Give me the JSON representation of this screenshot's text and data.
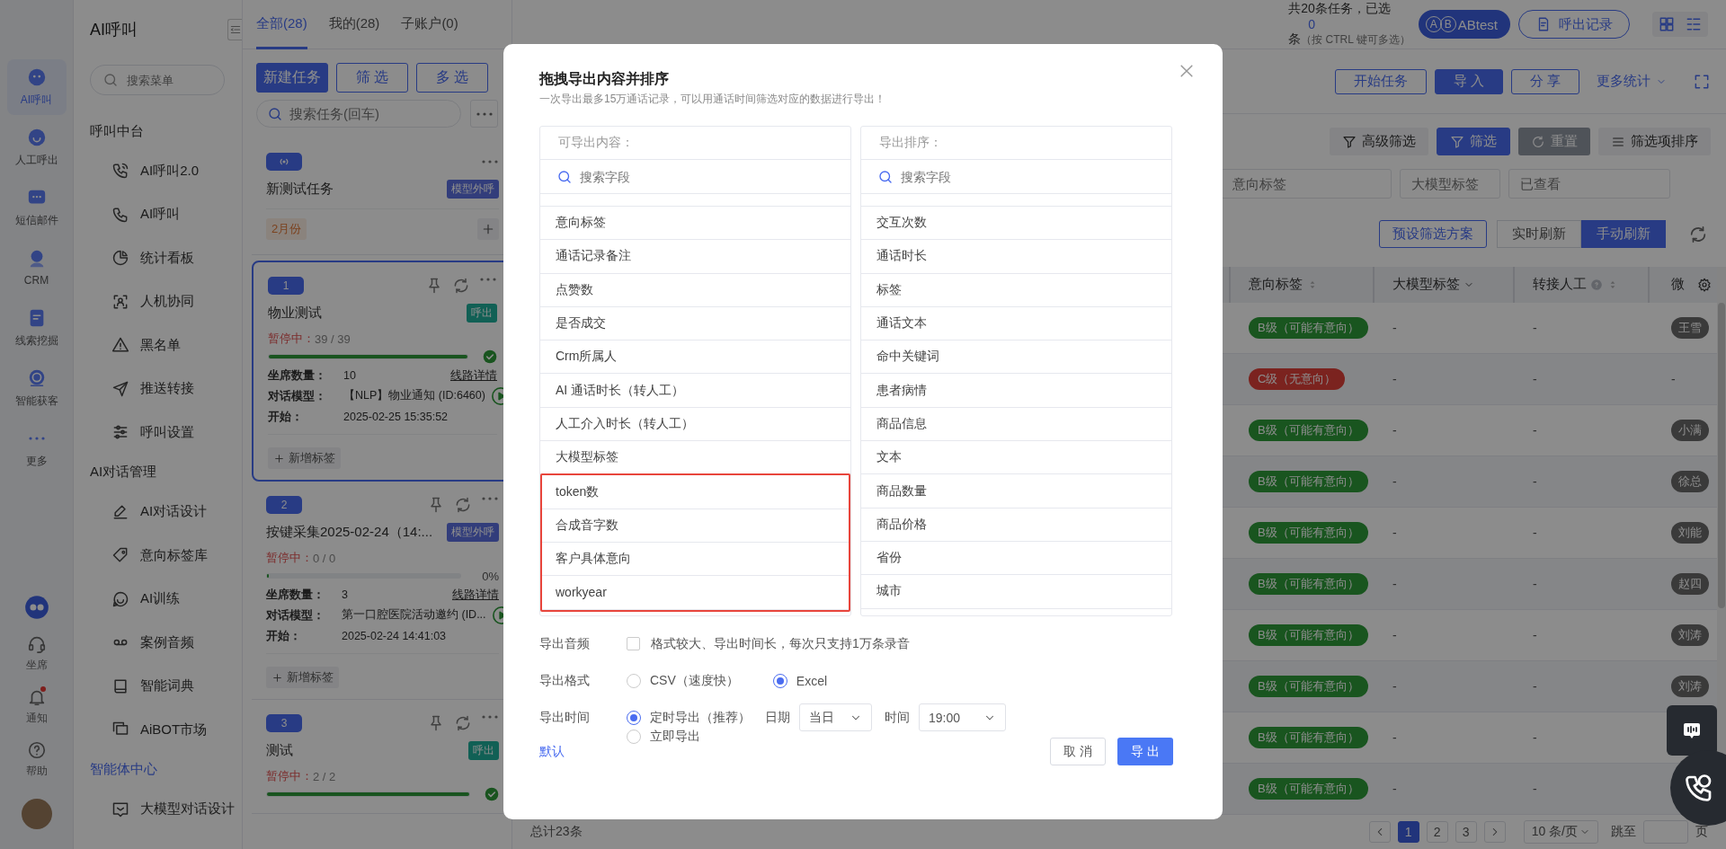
{
  "rail": {
    "items": [
      {
        "label": "AI呼叫",
        "selected": true
      },
      {
        "label": "人工呼出",
        "selected": false
      },
      {
        "label": "短信邮件",
        "selected": false
      },
      {
        "label": "CRM",
        "selected": false
      },
      {
        "label": "线索挖掘",
        "selected": false
      },
      {
        "label": "智能获客",
        "selected": false
      },
      {
        "label": "更多",
        "selected": false
      }
    ],
    "bottom": [
      {
        "label": "坐席",
        "badge": false
      },
      {
        "label": "通知",
        "badge": true
      },
      {
        "label": "帮助",
        "badge": false
      }
    ]
  },
  "menu": {
    "title": "AI呼叫",
    "search": {
      "placeholder": "搜索菜单"
    },
    "groups": [
      {
        "title": "呼叫中台",
        "selected": false,
        "items": [
          "AI呼叫2.0",
          "AI呼叫",
          "统计看板",
          "人机协同",
          "黑名单",
          "推送转接",
          "呼叫设置"
        ]
      },
      {
        "title": "AI对话管理",
        "selected": false,
        "items": [
          "AI对话设计",
          "意向标签库",
          "AI训练",
          "案例音频",
          "智能词典",
          "AiBOT市场"
        ]
      },
      {
        "title": "智能体中心",
        "selected": true,
        "items": [
          "大模型对话设计"
        ]
      }
    ]
  },
  "task_panel": {
    "tabs": [
      {
        "label": "全部(28)",
        "selected": true
      },
      {
        "label": "我的(28)",
        "selected": false
      },
      {
        "label": "子账户(0)",
        "selected": false
      }
    ],
    "buttons": [
      {
        "label": "新建任务",
        "kind": "primary"
      },
      {
        "label": "筛 选",
        "kind": "outline"
      },
      {
        "label": "多 选",
        "kind": "outline"
      }
    ],
    "search": {
      "placeholder": "搜索任务(回车)"
    },
    "group_card": {
      "title": "新测试任务",
      "tag": {
        "text": "模型外呼",
        "color": "#323d7b"
      },
      "month_tag": "2月份"
    },
    "tasks": [
      {
        "number": "1",
        "selected": true,
        "name": "物业测试",
        "tag": {
          "text": "呼出",
          "color": "#116055"
        },
        "status": "暂停中：",
        "count": "39 / 39",
        "level": 1,
        "fields": [
          {
            "label": "坐席数量：",
            "value": "10"
          },
          {
            "label": "对话模型：",
            "value": "【NLP】物业通知 (ID:6460)"
          },
          {
            "label": "开始：",
            "value": "2025-02-25 15:35:52"
          }
        ],
        "link": "线路详情",
        "add_tag": "新增标签"
      },
      {
        "number": "2",
        "selected": false,
        "name": "按键采集2025-02-24（14:...",
        "tag": {
          "text": "模型外呼",
          "color": "#323d7b"
        },
        "status": "暂停中：",
        "count": "0 / 0",
        "level": 0,
        "percent": "0%",
        "fields": [
          {
            "label": "坐席数量：",
            "value": "3"
          },
          {
            "label": "对话模型：",
            "value": "第一口腔医院活动邀约 (ID..."
          },
          {
            "label": "开始：",
            "value": "2025-02-24 14:41:03"
          }
        ],
        "link": "线路详情",
        "add_tag": "新增标签"
      },
      {
        "number": "3",
        "selected": false,
        "name": "测试",
        "tag": {
          "text": "呼出",
          "color": "#116055"
        },
        "status": "暂停中：",
        "count": "2 / 2",
        "level": 1
      }
    ]
  },
  "main": {
    "summary": [
      {
        "text": "共20条任务，已选",
        "kind": "plain"
      },
      {
        "text": "0",
        "kind": "count"
      },
      {
        "text": "条",
        "kind": "plain"
      }
    ],
    "summary_hint": "（按 CTRL 键可多选）",
    "ab_letters": [
      "A",
      "B"
    ],
    "ab_button": "ABtest",
    "records_button": "呼出记录",
    "actions": [
      {
        "label": "开始任务",
        "kind": "outline"
      },
      {
        "label": "导 入",
        "kind": "primary"
      },
      {
        "label": "分 享",
        "kind": "outline"
      },
      {
        "label": "更多统计",
        "kind": "dropdown"
      }
    ],
    "filter_actions": [
      {
        "label": "高级筛选",
        "kind": "plain"
      },
      {
        "label": "筛选",
        "kind": "primary"
      },
      {
        "label": "重置",
        "kind": "dark"
      },
      {
        "label": "筛选项排序",
        "kind": "plain"
      }
    ],
    "filter_fields": [
      {
        "placeholder": "意向标签"
      },
      {
        "placeholder": "大模型标签"
      },
      {
        "placeholder": "已查看"
      }
    ],
    "preset_button": "预设筛选方案",
    "refresh_modes": [
      {
        "label": "实时刷新",
        "selected": false
      },
      {
        "label": "手动刷新",
        "selected": true
      }
    ],
    "table": {
      "columns": [
        {
          "label": "意向标签",
          "kind": "sortable"
        },
        {
          "label": "大模型标签",
          "kind": "dropdown"
        },
        {
          "label": "转接人工",
          "kind": "help_sortable"
        },
        {
          "label": "微",
          "kind": "plain"
        }
      ],
      "rows": [
        {
          "intent": {
            "text": "B级（可能有意向）",
            "color": "#1a5520"
          },
          "model_tag": "-",
          "transfer": "-",
          "agent": {
            "text": "王雪",
            "kind": "badge"
          }
        },
        {
          "intent": {
            "text": "C级（无意向）",
            "color": "#7b2320"
          },
          "model_tag": "-",
          "transfer": "-",
          "agent": {
            "text": "-",
            "kind": "plain"
          }
        },
        {
          "intent": {
            "text": "B级（可能有意向）",
            "color": "#1a5520"
          },
          "model_tag": "-",
          "transfer": "-",
          "agent": {
            "text": "小满",
            "kind": "badge"
          }
        },
        {
          "intent": {
            "text": "B级（可能有意向）",
            "color": "#1a5520"
          },
          "model_tag": "-",
          "transfer": "-",
          "agent": {
            "text": "徐总",
            "kind": "badge"
          }
        },
        {
          "intent": {
            "text": "B级（可能有意向）",
            "color": "#1a5520"
          },
          "model_tag": "-",
          "transfer": "-",
          "agent": {
            "text": "刘能",
            "kind": "badge"
          }
        },
        {
          "intent": {
            "text": "B级（可能有意向）",
            "color": "#1a5520"
          },
          "model_tag": "-",
          "transfer": "-",
          "agent": {
            "text": "赵四",
            "kind": "badge"
          }
        },
        {
          "intent": {
            "text": "B级（可能有意向）",
            "color": "#1a5520"
          },
          "model_tag": "-",
          "transfer": "-",
          "agent": {
            "text": "刘涛",
            "kind": "badge"
          }
        },
        {
          "intent": {
            "text": "B级（可能有意向）",
            "color": "#1a5520"
          },
          "model_tag": "-",
          "transfer": "-",
          "agent": {
            "text": "刘涛",
            "kind": "badge"
          }
        },
        {
          "intent": {
            "text": "B级（可能有意向）",
            "color": "#1a5520"
          },
          "model_tag": "-",
          "transfer": "-"
        },
        {
          "intent": {
            "text": "B级（可能有意向）",
            "color": "#1a5520"
          },
          "model_tag": "-",
          "transfer": "-"
        }
      ]
    },
    "footer": {
      "total": "总计23条",
      "pages": [
        {
          "label": "1",
          "selected": true
        },
        {
          "label": "2",
          "selected": false
        },
        {
          "label": "3",
          "selected": false
        }
      ],
      "page_size": "10 条/页",
      "jump_label": "跳至",
      "page_unit": "页"
    }
  },
  "modal": {
    "title": "拖拽导出内容并排序",
    "subtitle": "一次导出最多15万通话记录，可以用通话时间筛选对应的数据进行导出！",
    "panels": [
      {
        "header": "可导出内容：",
        "search_placeholder": "搜索字段",
        "items": [
          {
            "label": "意向标签",
            "highlighted": false
          },
          {
            "label": "通话记录备注",
            "highlighted": false
          },
          {
            "label": "点赞数",
            "highlighted": false
          },
          {
            "label": "是否成交",
            "highlighted": false
          },
          {
            "label": "Crm所属人",
            "highlighted": false
          },
          {
            "label": "AI 通话时长（转人工）",
            "highlighted": false
          },
          {
            "label": "人工介入时长（转人工）",
            "highlighted": false
          },
          {
            "label": "大模型标签",
            "highlighted": false
          },
          {
            "label": "token数",
            "highlighted": true
          },
          {
            "label": "合成音字数",
            "highlighted": true
          },
          {
            "label": "客户具体意向",
            "highlighted": true
          },
          {
            "label": "workyear",
            "highlighted": true
          }
        ]
      },
      {
        "header": "导出排序：",
        "search_placeholder": "搜索字段",
        "items": [
          {
            "label": "交互次数",
            "highlighted": false
          },
          {
            "label": "通话时长",
            "highlighted": false
          },
          {
            "label": "标签",
            "highlighted": false
          },
          {
            "label": "通话文本",
            "highlighted": false
          },
          {
            "label": "命中关键词",
            "highlighted": false
          },
          {
            "label": "患者病情",
            "highlighted": false
          },
          {
            "label": "商品信息",
            "highlighted": false
          },
          {
            "label": "文本",
            "highlighted": false
          },
          {
            "label": "商品数量",
            "highlighted": false
          },
          {
            "label": "商品价格",
            "highlighted": false
          },
          {
            "label": "省份",
            "highlighted": false
          },
          {
            "label": "城市",
            "highlighted": false
          }
        ]
      }
    ],
    "audio": {
      "label": "导出音频",
      "checked": false,
      "text": "格式较大、导出时间长，每次只支持1万条录音"
    },
    "format": {
      "label": "导出格式",
      "choices": [
        {
          "label": "CSV（速度快）",
          "selected": false
        },
        {
          "label": "Excel",
          "selected": true
        }
      ]
    },
    "time": {
      "label": "导出时间",
      "choices": [
        {
          "label": "定时导出（推荐）",
          "selected": true
        },
        {
          "label": "立即导出",
          "selected": false
        }
      ],
      "date_label": "日期",
      "date_value": "当日",
      "time_label": "时间",
      "time_value": "19:00"
    },
    "default_link": "默认",
    "cancel": "取 消",
    "confirm": "导 出"
  }
}
